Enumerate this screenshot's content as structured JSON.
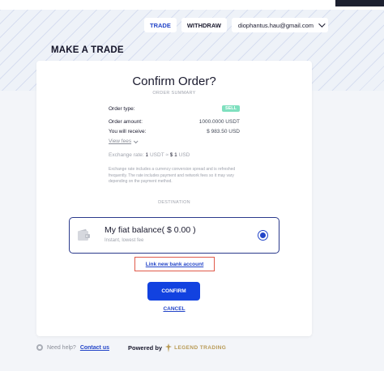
{
  "nav": {
    "trade": "TRADE",
    "withdraw": "WITHDRAW",
    "user_email": "diophantus.hau@gmail.com"
  },
  "page_title": "MAKE A TRADE",
  "order": {
    "title": "Confirm Order?",
    "summary_label": "ORDER SUMMARY",
    "rows": [
      {
        "label": "Order type:",
        "value": "SELL"
      },
      {
        "label": "Order amount:",
        "value": "1000.0000 USDT"
      },
      {
        "label": "You will receive:",
        "value": "$ 983.50 USD"
      }
    ],
    "view_fees": "View fees",
    "exchange_rate_label": "Exchange rate:",
    "exchange_rate_from": "1",
    "exchange_rate_unit_from": "USDT",
    "exchange_rate_eq": "≈",
    "exchange_rate_to": "$ 1",
    "exchange_rate_unit_to": "USD",
    "disclaimer": "Exchange rate includes a currency conversion spread and is refreshed frequently. The rate includes payment and network fees so it may vary depending on the payment method."
  },
  "destination": {
    "label": "DESTINATION",
    "option_title": "My fiat balance( $ 0.00 )",
    "option_subtitle": "Instant, lowest fee",
    "link_bank": "Link new bank account"
  },
  "actions": {
    "confirm": "CONFIRM",
    "cancel": "CANCEL"
  },
  "footer": {
    "need_help": "Need help?",
    "contact": "Contact us",
    "powered_by": "Powered by",
    "brand": "LEGEND TRADING"
  },
  "colors": {
    "accent": "#1242e0",
    "sell_badge": "#7fe0bf",
    "highlight_border": "#e05a4a",
    "brand_gold": "#b89a55"
  }
}
